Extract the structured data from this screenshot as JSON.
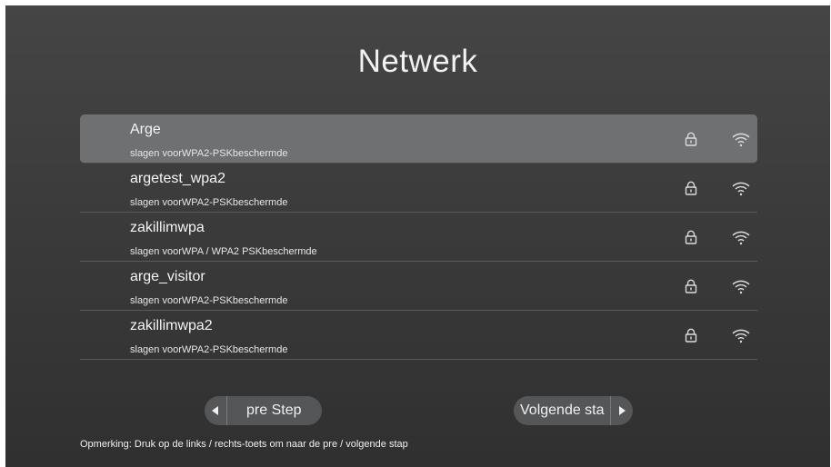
{
  "page": {
    "title": "Netwerk"
  },
  "networks": [
    {
      "ssid": "Arge",
      "security": "slagen voorWPA2-PSKbeschermde",
      "selected": true,
      "lock_icon": "lock-icon",
      "signal_icon": "wifi-signal-icon"
    },
    {
      "ssid": "argetest_wpa2",
      "security": "slagen voorWPA2-PSKbeschermde",
      "selected": false,
      "lock_icon": "lock-icon",
      "signal_icon": "wifi-signal-icon"
    },
    {
      "ssid": "zakillimwpa",
      "security": "slagen voorWPA / WPA2 PSKbeschermde",
      "selected": false,
      "lock_icon": "lock-icon",
      "signal_icon": "wifi-signal-icon"
    },
    {
      "ssid": "arge_visitor",
      "security": "slagen voorWPA2-PSKbeschermde",
      "selected": false,
      "lock_icon": "lock-icon",
      "signal_icon": "wifi-signal-icon"
    },
    {
      "ssid": "zakillimwpa2",
      "security": "slagen voorWPA2-PSKbeschermde",
      "selected": false,
      "lock_icon": "lock-icon",
      "signal_icon": "wifi-signal-icon"
    }
  ],
  "buttons": {
    "prev_label": "pre Step",
    "next_label": "Volgende sta",
    "prev_icon": "arrow-left-icon",
    "next_icon": "arrow-right-icon"
  },
  "footer": {
    "note": "Opmerking: Druk op de links / rechts-toets om naar de pre / volgende stap"
  },
  "colors": {
    "background": "#3b3b3b",
    "selected_row": "#6f7072",
    "button": "#555657",
    "text": "#f5f5f5"
  }
}
